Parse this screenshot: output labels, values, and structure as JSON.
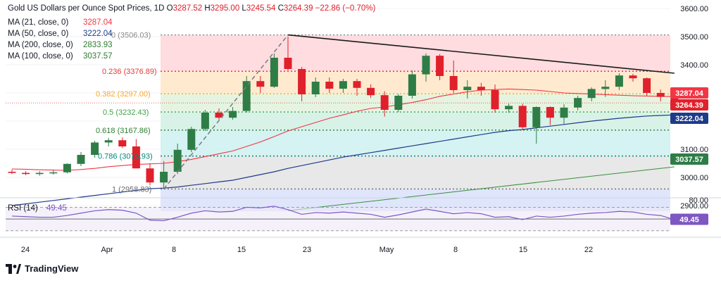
{
  "header": {
    "symbol": "Gold US Dollars per Ounce Spot Prices, 1D",
    "ohlc": [
      {
        "k": "O",
        "v": "3287.52"
      },
      {
        "k": "H",
        "v": "3295.00"
      },
      {
        "k": "L",
        "v": "3245.54"
      },
      {
        "k": "C",
        "v": "3264.39"
      }
    ],
    "change": "−22.86 (−0.70%)"
  },
  "ma_legend": [
    {
      "label": "MA (21, close, 0)",
      "value": "3287.04",
      "color": "#f23645"
    },
    {
      "label": "MA (50, close, 0)",
      "value": "3222.04",
      "color": "#1e3a8a"
    },
    {
      "label": "MA (200, close, 0)",
      "value": "2833.93",
      "color": "#2e7d32"
    },
    {
      "label": "MA (100, close, 0)",
      "value": "3037.57",
      "color": "#2e7d32"
    }
  ],
  "colors": {
    "up": "#2e7d46",
    "down": "#e0202b",
    "text": "#131722",
    "grid": "#f0f3fa",
    "rsi_line": "#7e57c2"
  },
  "chart_data": {
    "type": "candlestick",
    "ylim": [
      2880,
      3620
    ],
    "y_ticks": [
      "3600.00",
      "3500.00",
      "3400.00",
      "3300.00",
      "3200.00",
      "3100.00",
      "3000.00",
      "2900.00"
    ],
    "x_ticks": [
      "24",
      "Apr",
      "8",
      "15",
      "23",
      "May",
      "8",
      "15",
      "22"
    ],
    "candles": [
      [
        3020,
        3028,
        3012,
        3016
      ],
      [
        3016,
        3022,
        3008,
        3012
      ],
      [
        3012,
        3022,
        3006,
        3016
      ],
      [
        3016,
        3026,
        3010,
        3018
      ],
      [
        3018,
        3050,
        3014,
        3048
      ],
      [
        3048,
        3090,
        3040,
        3080
      ],
      [
        3080,
        3130,
        3070,
        3124
      ],
      [
        3124,
        3140,
        3110,
        3132
      ],
      [
        3132,
        3142,
        3104,
        3110
      ],
      [
        3110,
        3136,
        3072,
        3032
      ],
      [
        3032,
        3050,
        2972,
        2982
      ],
      [
        2982,
        3058,
        2958,
        3020
      ],
      [
        3020,
        3120,
        3012,
        3098
      ],
      [
        3098,
        3180,
        3090,
        3172
      ],
      [
        3172,
        3240,
        3165,
        3230
      ],
      [
        3230,
        3245,
        3205,
        3212
      ],
      [
        3212,
        3250,
        3205,
        3236
      ],
      [
        3236,
        3360,
        3230,
        3342
      ],
      [
        3342,
        3360,
        3300,
        3322
      ],
      [
        3322,
        3440,
        3318,
        3425
      ],
      [
        3425,
        3500,
        3380,
        3385
      ],
      [
        3385,
        3392,
        3270,
        3295
      ],
      [
        3295,
        3355,
        3285,
        3340
      ],
      [
        3340,
        3355,
        3300,
        3315
      ],
      [
        3315,
        3350,
        3300,
        3342
      ],
      [
        3342,
        3350,
        3290,
        3318
      ],
      [
        3318,
        3330,
        3282,
        3292
      ],
      [
        3292,
        3306,
        3216,
        3240
      ],
      [
        3240,
        3296,
        3232,
        3290
      ],
      [
        3290,
        3380,
        3280,
        3366
      ],
      [
        3366,
        3440,
        3340,
        3432
      ],
      [
        3432,
        3438,
        3345,
        3360
      ],
      [
        3360,
        3415,
        3300,
        3310
      ],
      [
        3310,
        3345,
        3280,
        3322
      ],
      [
        3322,
        3336,
        3290,
        3310
      ],
      [
        3310,
        3330,
        3230,
        3242
      ],
      [
        3242,
        3262,
        3230,
        3254
      ],
      [
        3254,
        3262,
        3168,
        3178
      ],
      [
        3178,
        3252,
        3120,
        3250
      ],
      [
        3250,
        3252,
        3186,
        3212
      ],
      [
        3212,
        3260,
        3190,
        3248
      ],
      [
        3248,
        3290,
        3238,
        3282
      ],
      [
        3282,
        3320,
        3270,
        3314
      ],
      [
        3314,
        3345,
        3286,
        3322
      ],
      [
        3322,
        3370,
        3310,
        3362
      ],
      [
        3362,
        3368,
        3340,
        3352
      ],
      [
        3352,
        3355,
        3290,
        3300
      ],
      [
        3300,
        3312,
        3270,
        3286
      ],
      [
        3286,
        3295,
        3245,
        3264
      ]
    ],
    "trendline": {
      "from": [
        20,
        3506
      ],
      "to": [
        48,
        3370
      ]
    },
    "fib_dashed_line": {
      "from": [
        11,
        2958.83
      ],
      "to": [
        20,
        3506.03
      ]
    },
    "fib_levels": [
      {
        "ratio": "0",
        "value": 3506.03,
        "label": "0 (3506.03)"
      },
      {
        "ratio": "0.236",
        "value": 3376.89,
        "label": "0.236 (3376.89)"
      },
      {
        "ratio": "0.382",
        "value": 3297.0,
        "label": "0.382 (3297.00)"
      },
      {
        "ratio": "0.5",
        "value": 3232.43,
        "label": "0.5 (3232.43)"
      },
      {
        "ratio": "0.618",
        "value": 3167.86,
        "label": "0.618 (3167.86)"
      },
      {
        "ratio": "0.786",
        "value": 3075.93,
        "label": "0.786 (3075.93)"
      },
      {
        "ratio": "1",
        "value": 2958.83,
        "label": "1 (2958.83)"
      }
    ],
    "ma21": [
      3030,
      3029,
      3027,
      3026,
      3025,
      3028,
      3032,
      3038,
      3042,
      3046,
      3048,
      3050,
      3056,
      3064,
      3074,
      3084,
      3094,
      3110,
      3126,
      3145,
      3165,
      3180,
      3195,
      3210,
      3222,
      3235,
      3245,
      3250,
      3258,
      3266,
      3276,
      3288,
      3296,
      3304,
      3310,
      3312,
      3314,
      3312,
      3310,
      3305,
      3300,
      3298,
      3296,
      3294,
      3292,
      3290,
      3289,
      3288,
      3287
    ],
    "ma50": [
      2900,
      2906,
      2912,
      2918,
      2924,
      2930,
      2936,
      2942,
      2948,
      2954,
      2960,
      2962,
      2966,
      2972,
      2978,
      2984,
      2990,
      3000,
      3010,
      3020,
      3032,
      3042,
      3052,
      3062,
      3072,
      3080,
      3088,
      3096,
      3104,
      3112,
      3120,
      3128,
      3136,
      3144,
      3152,
      3160,
      3166,
      3170,
      3176,
      3182,
      3188,
      3194,
      3200,
      3205,
      3210,
      3214,
      3218,
      3220,
      3222
    ],
    "ma100_visible": {
      "from": [
        20,
        2882
      ],
      "to": [
        48,
        3037.57
      ]
    },
    "price_tags": [
      {
        "value": 3287.04,
        "text": "3287.04",
        "bg": "#f23645"
      },
      {
        "value": 3264.39,
        "text": "3264.39",
        "bg": "#e0202b"
      },
      {
        "value": 3222.04,
        "text": "3222.04",
        "bg": "#1e3a8a"
      },
      {
        "value": 3037.57,
        "text": "3037.57",
        "bg": "#2e7d46"
      }
    ],
    "rsi": {
      "label": "RSI (14)",
      "value": "49.45",
      "ylim": [
        20,
        85
      ],
      "tick": "80.00",
      "upper": 70,
      "lower": 30,
      "values": [
        55,
        54,
        53,
        53,
        56,
        60,
        64,
        66,
        65,
        60,
        48,
        47,
        53,
        60,
        64,
        62,
        63,
        70,
        69,
        72,
        66,
        58,
        61,
        60,
        62,
        60,
        58,
        53,
        57,
        62,
        67,
        63,
        59,
        61,
        59,
        53,
        54,
        49,
        55,
        53,
        55,
        58,
        60,
        61,
        63,
        62,
        58,
        56,
        49
      ]
    }
  },
  "branding": {
    "logo_text": "TradingView"
  }
}
